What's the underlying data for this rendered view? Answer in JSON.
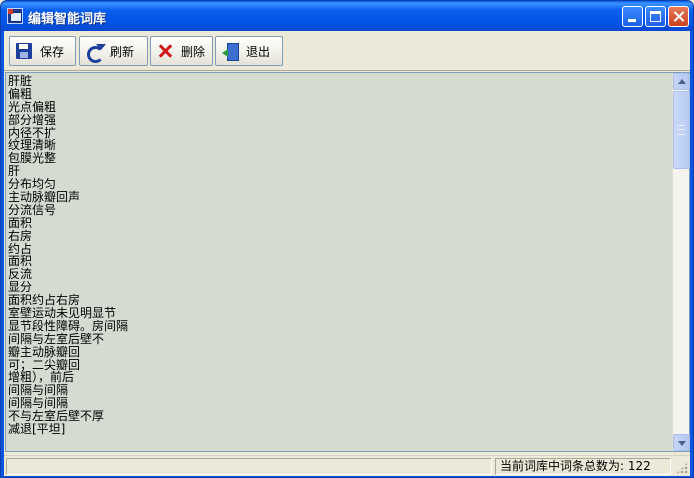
{
  "window": {
    "title": "编辑智能词库"
  },
  "toolbar": {
    "save_label": "保存",
    "refresh_label": "刷新",
    "delete_label": "删除",
    "exit_label": "退出"
  },
  "editor": {
    "lines": [
      "肝脏",
      "偏粗",
      "光点偏粗",
      "部分增强",
      "内径不扩",
      "纹理清晰",
      "包膜光整",
      "肝",
      "分布均匀",
      "主动脉瓣回声",
      "分流信号",
      "面积",
      "右房",
      "约占",
      "面积",
      "反流",
      "显分",
      "面积约占右房",
      "室壁运动未见明显节",
      "显节段性障碍。房间隔",
      "间隔与左室后壁不",
      "瓣主动脉瓣回",
      "可；二尖瓣回",
      "增粗），前后",
      "间隔与间隔",
      "间隔与间隔",
      "不与左室后壁不厚",
      "减退[平坦]"
    ]
  },
  "status": {
    "word_count_text": "当前词库中词条总数为:  122"
  },
  "colors": {
    "titlebar": "#0A5FEF",
    "editor_background": "#D4DCD2",
    "window_background": "#ECE9D8"
  }
}
